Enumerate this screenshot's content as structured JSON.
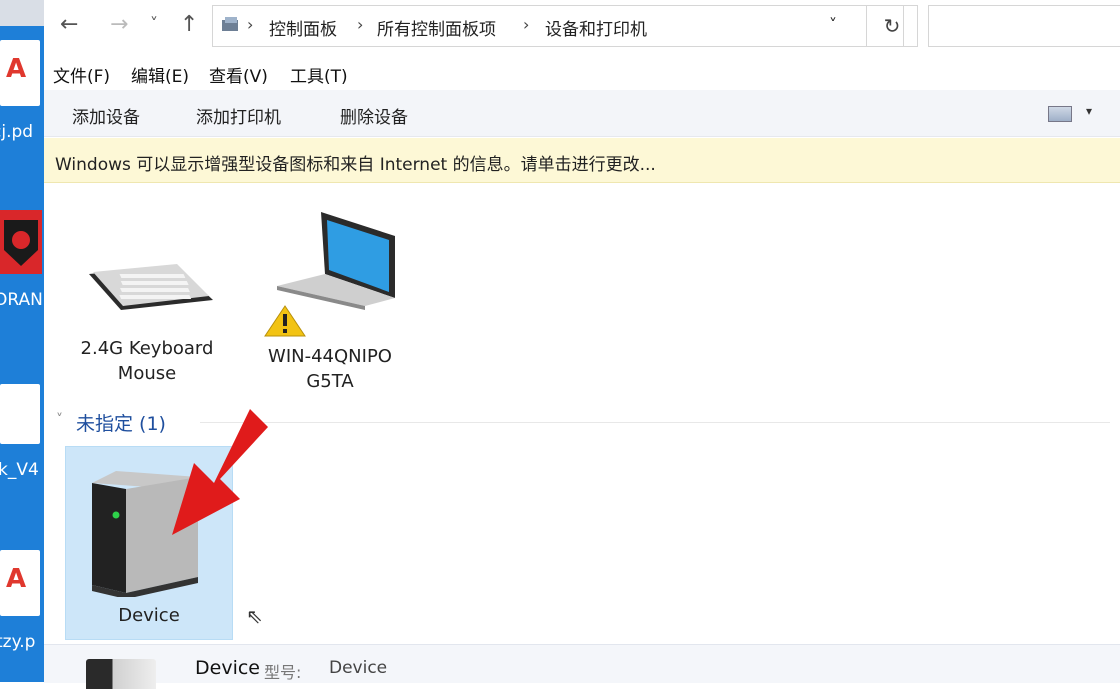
{
  "nav": {
    "back": "←",
    "forward": "→",
    "history": "˅",
    "up": "↑"
  },
  "breadcrumbs": [
    {
      "label": "控制面板"
    },
    {
      "label": "所有控制面板项"
    },
    {
      "label": "设备和打印机"
    }
  ],
  "address": {
    "dropdown": "˅",
    "refresh": "↻"
  },
  "menu": [
    "文件(F)",
    "编辑(E)",
    "查看(V)",
    "工具(T)"
  ],
  "toolbar": {
    "add_device": "添加设备",
    "add_printer": "添加打印机",
    "remove_device": "删除设备"
  },
  "infobar": {
    "text": "Windows 可以显示增强型设备图标和来自 Internet 的信息。请单击进行更改..."
  },
  "devices": [
    {
      "label_line1": "2.4G Keyboard",
      "label_line2": "Mouse",
      "icon": "keyboard-icon"
    },
    {
      "label_line1": "WIN-44QNIPO",
      "label_line2": "G5TA",
      "icon": "laptop-icon",
      "badge": "warning-icon"
    }
  ],
  "unspecified_group": {
    "title": "未指定 (1)",
    "chevron": "˅"
  },
  "unspecified_device": {
    "label": "Device",
    "icon": "device-box-icon"
  },
  "details_pane": {
    "name": "Device",
    "model_key": "型号:",
    "model_value": "Device"
  },
  "desktop_labels": [
    "cj.pd",
    "ORAN",
    "k_V4",
    "tzy.p"
  ],
  "colors": {
    "accent": "#1f4f9e",
    "selection": "#cde6f9",
    "infobar": "#fdf8d6",
    "arrow": "#e01b1b"
  }
}
